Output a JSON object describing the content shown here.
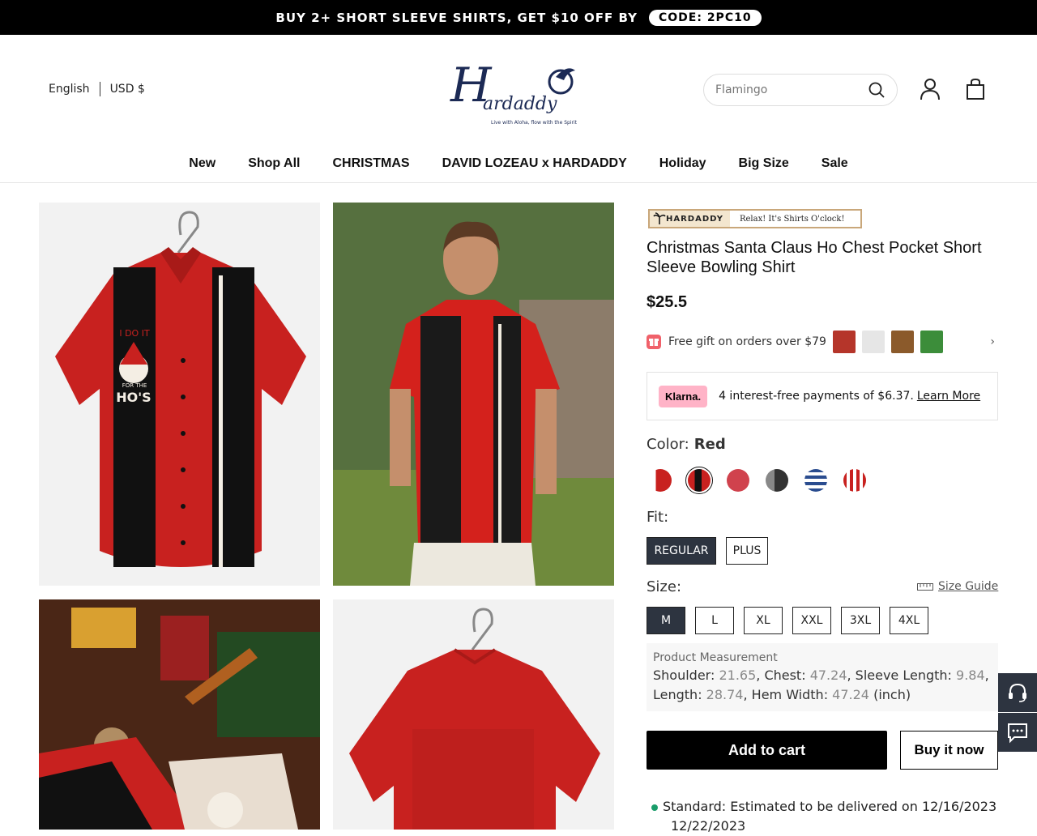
{
  "announcement": {
    "text": "BUY 2+ SHORT SLEEVE SHIRTS,  GET $10 OFF BY",
    "code": "CODE: 2PC10"
  },
  "header": {
    "language": "English",
    "currency": "USD $",
    "logo_text": "Hardaddy",
    "logo_tagline": "Live with Aloha, flow with the Spirit",
    "search_placeholder": "Flamingo"
  },
  "nav": [
    "New",
    "Shop All",
    "CHRISTMAS",
    "DAVID LOZEAU x HARDADDY",
    "Holiday",
    "Big Size",
    "Sale"
  ],
  "product": {
    "badge_brand": "HARDADDY",
    "badge_slogan": "Relax! It's Shirts O'clock!",
    "title": "Christmas Santa Claus Ho Chest Pocket Short Sleeve Bowling Shirt",
    "price": "$25.5",
    "shirt_print": {
      "line1": "I DO IT",
      "line2": "FOR THE",
      "line3": "HO'S"
    },
    "gift_text": "Free gift on orders over $79",
    "klarna": {
      "logo": "Klarna.",
      "text": "4 interest-free payments of $6.37.",
      "link": "Learn More"
    },
    "color_label": "Color:",
    "color_value": "Red",
    "fit_label": "Fit:",
    "fits": [
      "REGULAR",
      "PLUS"
    ],
    "size_label": "Size:",
    "size_guide": "Size Guide",
    "sizes": [
      "M",
      "L",
      "XL",
      "XXL",
      "3XL",
      "4XL"
    ],
    "measurement": {
      "heading": "Product Measurement",
      "shoulder_label": "Shoulder:",
      "shoulder": "21.65",
      "chest_label": "Chest:",
      "chest": "47.24",
      "sleeve_label": "Sleeve Length:",
      "sleeve": "9.84",
      "length_label": "Length:",
      "length": "28.74",
      "hem_label": "Hem Width:",
      "hem": "47.24",
      "unit": "(inch)"
    },
    "add_to_cart": "Add to cart",
    "buy_now": "Buy it now",
    "shipping_line1": "Standard: Estimated to be delivered on 12/16/2023",
    "shipping_line2": "12/22/2023"
  },
  "colors": {
    "accent_black": "#000000",
    "selected_option": "#2d3440",
    "logo_navy": "#1c2a55",
    "shirt_red": "#c8211f",
    "klarna_pink": "#ffb3c7",
    "shipping_dot": "#1a9d6a"
  }
}
